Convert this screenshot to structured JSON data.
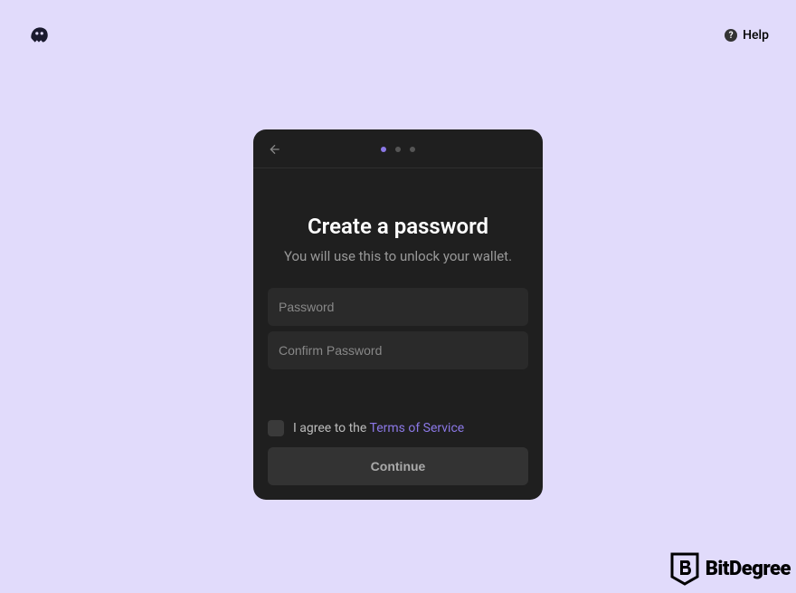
{
  "header": {
    "help_label": "Help"
  },
  "modal": {
    "title": "Create a password",
    "subtitle": "You will use this to unlock your wallet.",
    "password_placeholder": "Password",
    "confirm_password_placeholder": "Confirm Password",
    "terms_prefix": "I agree to the ",
    "terms_link": "Terms of Service",
    "continue_label": "Continue",
    "progress": {
      "current_step": 1,
      "total_steps": 3
    }
  },
  "watermark": {
    "brand": "BitDegree"
  },
  "colors": {
    "background": "#e1dbfb",
    "modal_bg": "#1f1f1f",
    "accent": "#8b78e6"
  }
}
